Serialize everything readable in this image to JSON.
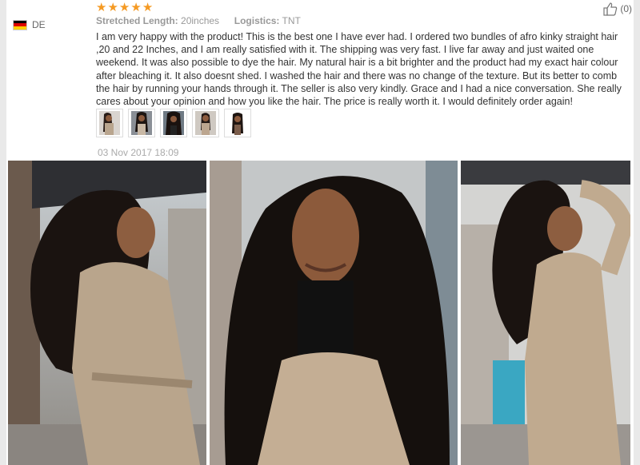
{
  "reviewer": {
    "country_code": "DE",
    "flag_colors": [
      "#000000",
      "#dd0000",
      "#ffce00"
    ]
  },
  "rating": {
    "stars": 5,
    "max": 5,
    "color": "#f59a23"
  },
  "attributes": {
    "length_label": "Stretched Length:",
    "length_value": "20inches",
    "logistics_label": "Logistics:",
    "logistics_value": "TNT"
  },
  "helpful": {
    "icon": "thumbs-up-icon",
    "count_text": "(0)"
  },
  "review_text": "I am very happy with the product! This is the best one I have ever had. I ordered two bundles of afro kinky straight hair ,20 and 22 Inches, and I am really satisfied with it. The shipping was very fast. I live far away and just waited one weekend. It was also possible to dye the hair. My natural hair is a bit brighter and the product had my exact hair colour after bleaching it. It also doesnt shed. I washed the hair and there was no change of the texture. But its better to comb the hair by running your hands through it. The seller is also very kindly. Grace and I had a nice conversation. She really cares about your opinion and how you like the hair. The price is really worth it. I would definitely order again!",
  "thumbnails": [
    {
      "name": "thumb-1"
    },
    {
      "name": "thumb-2"
    },
    {
      "name": "thumb-3"
    },
    {
      "name": "thumb-4"
    },
    {
      "name": "thumb-5"
    }
  ],
  "date": "03 Nov 2017 18:09"
}
